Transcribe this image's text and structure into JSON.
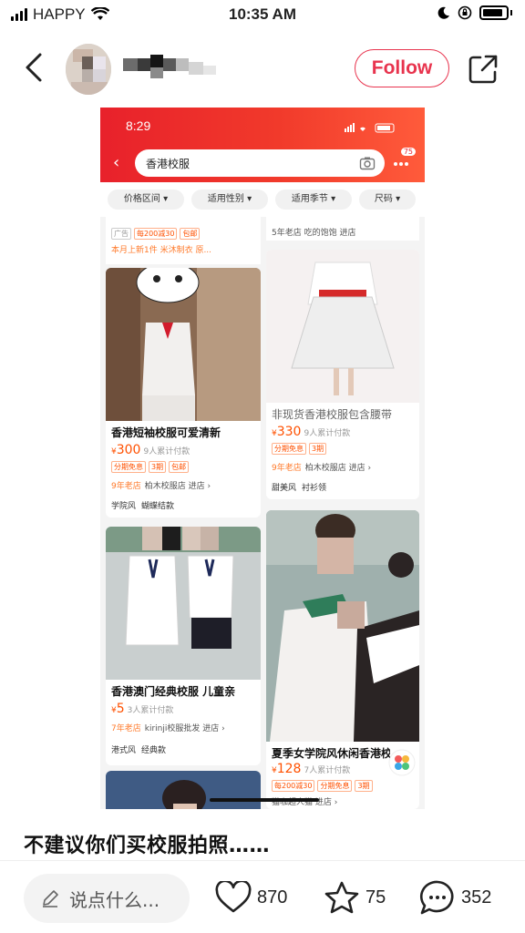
{
  "status_bar": {
    "carrier": "HAPPY",
    "time": "10:35 AM"
  },
  "header": {
    "follow_label": "Follow"
  },
  "embedded": {
    "time": "8:29",
    "search_query": "香港校服",
    "badge": "75",
    "filters": [
      "价格区间",
      "适用性别",
      "适用季节",
      "尺码"
    ],
    "top_partial": {
      "left_tags": [
        "广告",
        "每200减30",
        "包邮"
      ],
      "left_note": "本月上新1件 米沐制衣 原...",
      "right_shop": "5年老店 吃的饱饱 进店"
    },
    "products": [
      {
        "title": "香港短袖校服可爱清新",
        "price_symbol": "¥",
        "price": "300",
        "sold": "9人累计付款",
        "tags": [
          "分期免息",
          "3期",
          "包邮"
        ],
        "shop_age": "9年老店",
        "shop": "柏木校服店 进店",
        "keywords": [
          "学院风",
          "蝴蝶结款"
        ]
      },
      {
        "title": "非现货香港校服包含腰带",
        "price_symbol": "¥",
        "price": "330",
        "sold": "9人累计付款",
        "tags": [
          "分期免息",
          "3期"
        ],
        "shop_age": "9年老店",
        "shop": "柏木校服店 进店",
        "keywords": [
          "甜美风",
          "衬衫领"
        ]
      },
      {
        "title": "香港澳门经典校服 儿童亲",
        "price_symbol": "¥",
        "price": "5",
        "sold": "3人累计付款",
        "tags": [],
        "shop_age": "7年老店",
        "shop": "kirinji校服批发 进店",
        "keywords": [
          "港式风",
          "经典款"
        ]
      },
      {
        "title": "夏季女学院风休闲香港校",
        "price_symbol": "¥",
        "price": "128",
        "sold": "7人累计付款",
        "tags": [
          "每200减30",
          "分期免息",
          "3期"
        ],
        "shop_age": "",
        "shop": "猫咖超人猫 进店",
        "keywords": []
      }
    ]
  },
  "post": {
    "title": "不建议你们买校服拍照……"
  },
  "bottom_bar": {
    "comment_placeholder": "说点什么...",
    "likes": "870",
    "collects": "75",
    "comments": "352"
  },
  "colors": {
    "accent": "#e8344e",
    "embed_red": "#e8212b",
    "price_orange": "#ff5000"
  }
}
